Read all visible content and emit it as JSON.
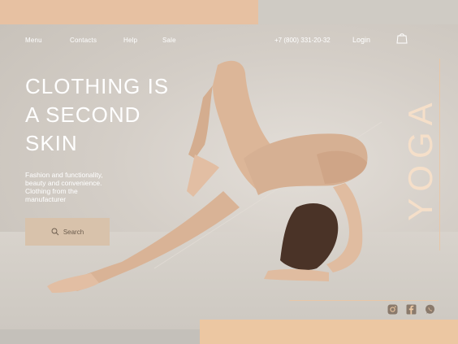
{
  "nav": {
    "items": [
      {
        "label": "Menu"
      },
      {
        "label": "Contacts"
      },
      {
        "label": "Help"
      },
      {
        "label": "Sale"
      }
    ],
    "phone": "+7 (800) 331-20-32",
    "login_label": "Login",
    "cart_icon": "shopping-bag-icon"
  },
  "hero": {
    "headline_lines": [
      "CLOTHING IS",
      "A SECOND",
      "SKIN"
    ],
    "subtext_lines": [
      "Fashion and functionality,",
      "beauty and convenience.",
      "Clothing from the",
      "manufacturer"
    ],
    "search_label": "Search",
    "vertical_word": "YOGA"
  },
  "social": {
    "icons": [
      "instagram-icon",
      "facebook-icon",
      "whatsapp-icon"
    ]
  },
  "colors": {
    "peach": "#e7c1a2",
    "beige_button": "#d8c2ab",
    "text_white": "#ffffff",
    "social_icon": "#8a7a6c"
  }
}
